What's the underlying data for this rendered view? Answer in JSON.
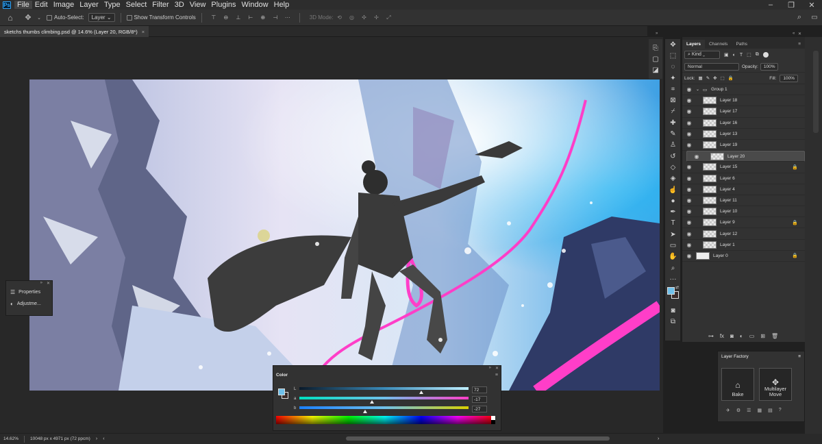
{
  "menubar": {
    "items": [
      "File",
      "Edit",
      "Image",
      "Layer",
      "Type",
      "Select",
      "Filter",
      "3D",
      "View",
      "Plugins",
      "Window",
      "Help"
    ],
    "window_controls": [
      "–",
      "❐",
      "✕"
    ]
  },
  "options": {
    "auto_select_label": "Auto-Select:",
    "auto_select_value": "Layer",
    "transform_label": "Show Transform Controls",
    "mode_3d": "3D Mode:"
  },
  "document": {
    "tab_title": "sketchs thumbs climbing.psd @ 14.6% (Layer 20, RGB/8*)",
    "close": "×"
  },
  "properties_panel": {
    "items": [
      "Properties",
      "Adjustme..."
    ]
  },
  "layers_panel": {
    "tabs": [
      "Layers",
      "Channels",
      "Paths"
    ],
    "kind_label": "Kind",
    "blend_mode": "Normal",
    "opacity_label": "Opacity:",
    "opacity_value": "100%",
    "lock_label": "Lock:",
    "fill_label": "Fill:",
    "fill_value": "100%",
    "group_name": "Group 1",
    "layers": [
      {
        "name": "Layer 18",
        "locked": false,
        "selected": false
      },
      {
        "name": "Layer 17",
        "locked": false,
        "selected": false
      },
      {
        "name": "Layer 16",
        "locked": false,
        "selected": false
      },
      {
        "name": "Layer 13",
        "locked": false,
        "selected": false
      },
      {
        "name": "Layer 19",
        "locked": false,
        "selected": false
      },
      {
        "name": "Layer 20",
        "locked": false,
        "selected": true
      },
      {
        "name": "Layer 15",
        "locked": true,
        "selected": false
      },
      {
        "name": "Layer 6",
        "locked": false,
        "selected": false
      },
      {
        "name": "Layer 4",
        "locked": false,
        "selected": false
      },
      {
        "name": "Layer 11",
        "locked": false,
        "selected": false
      },
      {
        "name": "Layer 10",
        "locked": false,
        "selected": false
      },
      {
        "name": "Layer 9",
        "locked": true,
        "selected": false
      },
      {
        "name": "Layer 12",
        "locked": false,
        "selected": false
      },
      {
        "name": "Layer 1",
        "locked": false,
        "selected": false
      },
      {
        "name": "Layer 0",
        "locked": true,
        "selected": false
      }
    ],
    "footer_icons": [
      "link-icon",
      "fx-icon",
      "mask-icon",
      "adjustment-icon",
      "folder-icon",
      "new-layer-icon",
      "trash-icon"
    ]
  },
  "layer_factory": {
    "title": "Layer Factory",
    "bake_label": "Bake",
    "multilayer_label": "Multilayer Move"
  },
  "color_panel": {
    "title": "Color",
    "channels": [
      {
        "label": "L",
        "value": "72",
        "position": 0.72
      },
      {
        "label": "a",
        "value": "-17",
        "position": 0.43
      },
      {
        "label": "b",
        "value": "-27",
        "position": 0.39
      }
    ],
    "foreground_color": "#6fc0ea",
    "background_color": "#3a2a28"
  },
  "status": {
    "zoom": "14.62%",
    "dimensions": "10048 px x 4971 px (72 ppcm)"
  },
  "colors": {
    "accent": "#31a8ff",
    "rope_pink": "#ff3ec8"
  }
}
